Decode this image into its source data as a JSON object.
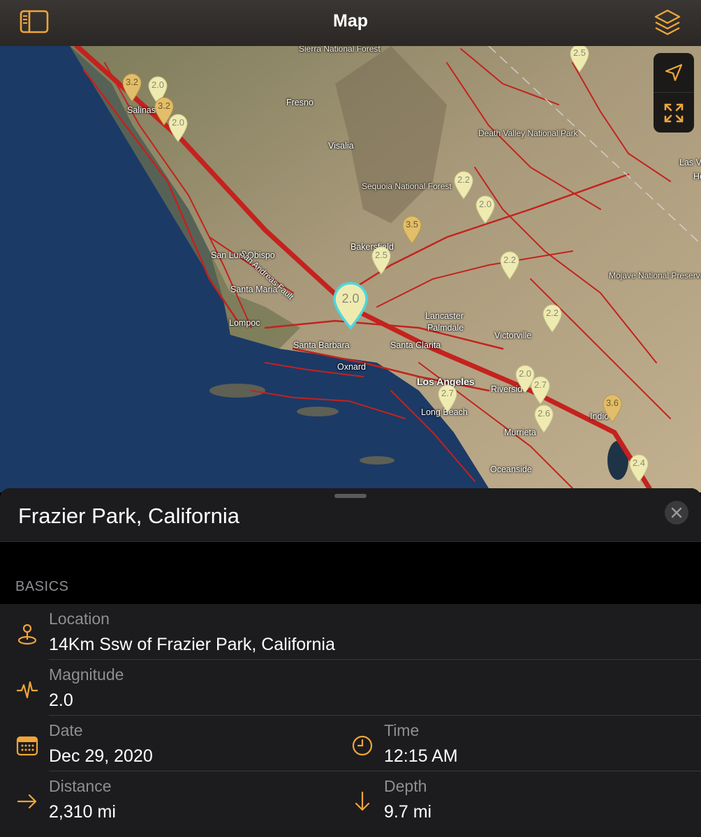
{
  "nav": {
    "title": "Map",
    "sidebar_icon": "sidebar-icon",
    "layers_icon": "layers-icon"
  },
  "map": {
    "controls": [
      {
        "icon": "location-arrow-icon"
      },
      {
        "icon": "expand-icon"
      }
    ],
    "cities": [
      {
        "name": "Salinas"
      },
      {
        "name": "Fresno"
      },
      {
        "name": "Visalia"
      },
      {
        "name": "Bakersfield"
      },
      {
        "name": "San Luis Obispo"
      },
      {
        "name": "Santa Maria"
      },
      {
        "name": "Lompoc"
      },
      {
        "name": "Santa Barbara"
      },
      {
        "name": "Oxnard"
      },
      {
        "name": "Santa Clarita"
      },
      {
        "name": "Lancaster"
      },
      {
        "name": "Palmdale"
      },
      {
        "name": "Victorville"
      },
      {
        "name": "Los Angeles"
      },
      {
        "name": "Long Beach"
      },
      {
        "name": "Riverside"
      },
      {
        "name": "Murrieta"
      },
      {
        "name": "Oceanside"
      },
      {
        "name": "Indio"
      },
      {
        "name": "Las Ve"
      },
      {
        "name": "He"
      }
    ],
    "parks": [
      {
        "name": "Sierra National Forest"
      },
      {
        "name": "Death Valley National Park"
      },
      {
        "name": "Sequoia National Forest"
      },
      {
        "name": "Mojave National Preserve"
      }
    ],
    "fault_label": "San Andreas Fault",
    "pins": [
      {
        "mag": "3.2",
        "strong": true
      },
      {
        "mag": "2.0",
        "strong": false
      },
      {
        "mag": "3.2",
        "strong": true
      },
      {
        "mag": "2.0",
        "strong": false
      },
      {
        "mag": "2.5",
        "strong": false
      },
      {
        "mag": "2.2",
        "strong": false
      },
      {
        "mag": "2.0",
        "strong": false
      },
      {
        "mag": "3.5",
        "strong": true
      },
      {
        "mag": "2.5",
        "strong": false
      },
      {
        "mag": "2.2",
        "strong": false
      },
      {
        "mag": "2.2",
        "strong": false
      },
      {
        "mag": "2.0",
        "strong": false
      },
      {
        "mag": "2.7",
        "strong": false
      },
      {
        "mag": "2.7",
        "strong": false
      },
      {
        "mag": "2.6",
        "strong": false
      },
      {
        "mag": "3.6",
        "strong": true
      },
      {
        "mag": "2.4",
        "strong": false
      }
    ],
    "selected_pin": {
      "mag": "2.0"
    }
  },
  "sheet": {
    "place_title": "Frazier Park, California",
    "section_title": "BASICS",
    "location_label": "Location",
    "location_value": "14Km Ssw of Frazier Park, California",
    "magnitude_label": "Magnitude",
    "magnitude_value": "2.0",
    "date_label": "Date",
    "date_value": "Dec 29, 2020",
    "time_label": "Time",
    "time_value": "12:15 AM",
    "distance_label": "Distance",
    "distance_value": "2,310 mi",
    "depth_label": "Depth",
    "depth_value": "9.7 mi"
  },
  "colors": {
    "accent": "#F0A53A",
    "fault": "#C4221E",
    "pin_light": "#EFEBB0",
    "pin_strong": "#E2BE6A",
    "selected_ring": "#4FD6DF",
    "ocean": "#1C3A66",
    "land": "#A89A78"
  }
}
